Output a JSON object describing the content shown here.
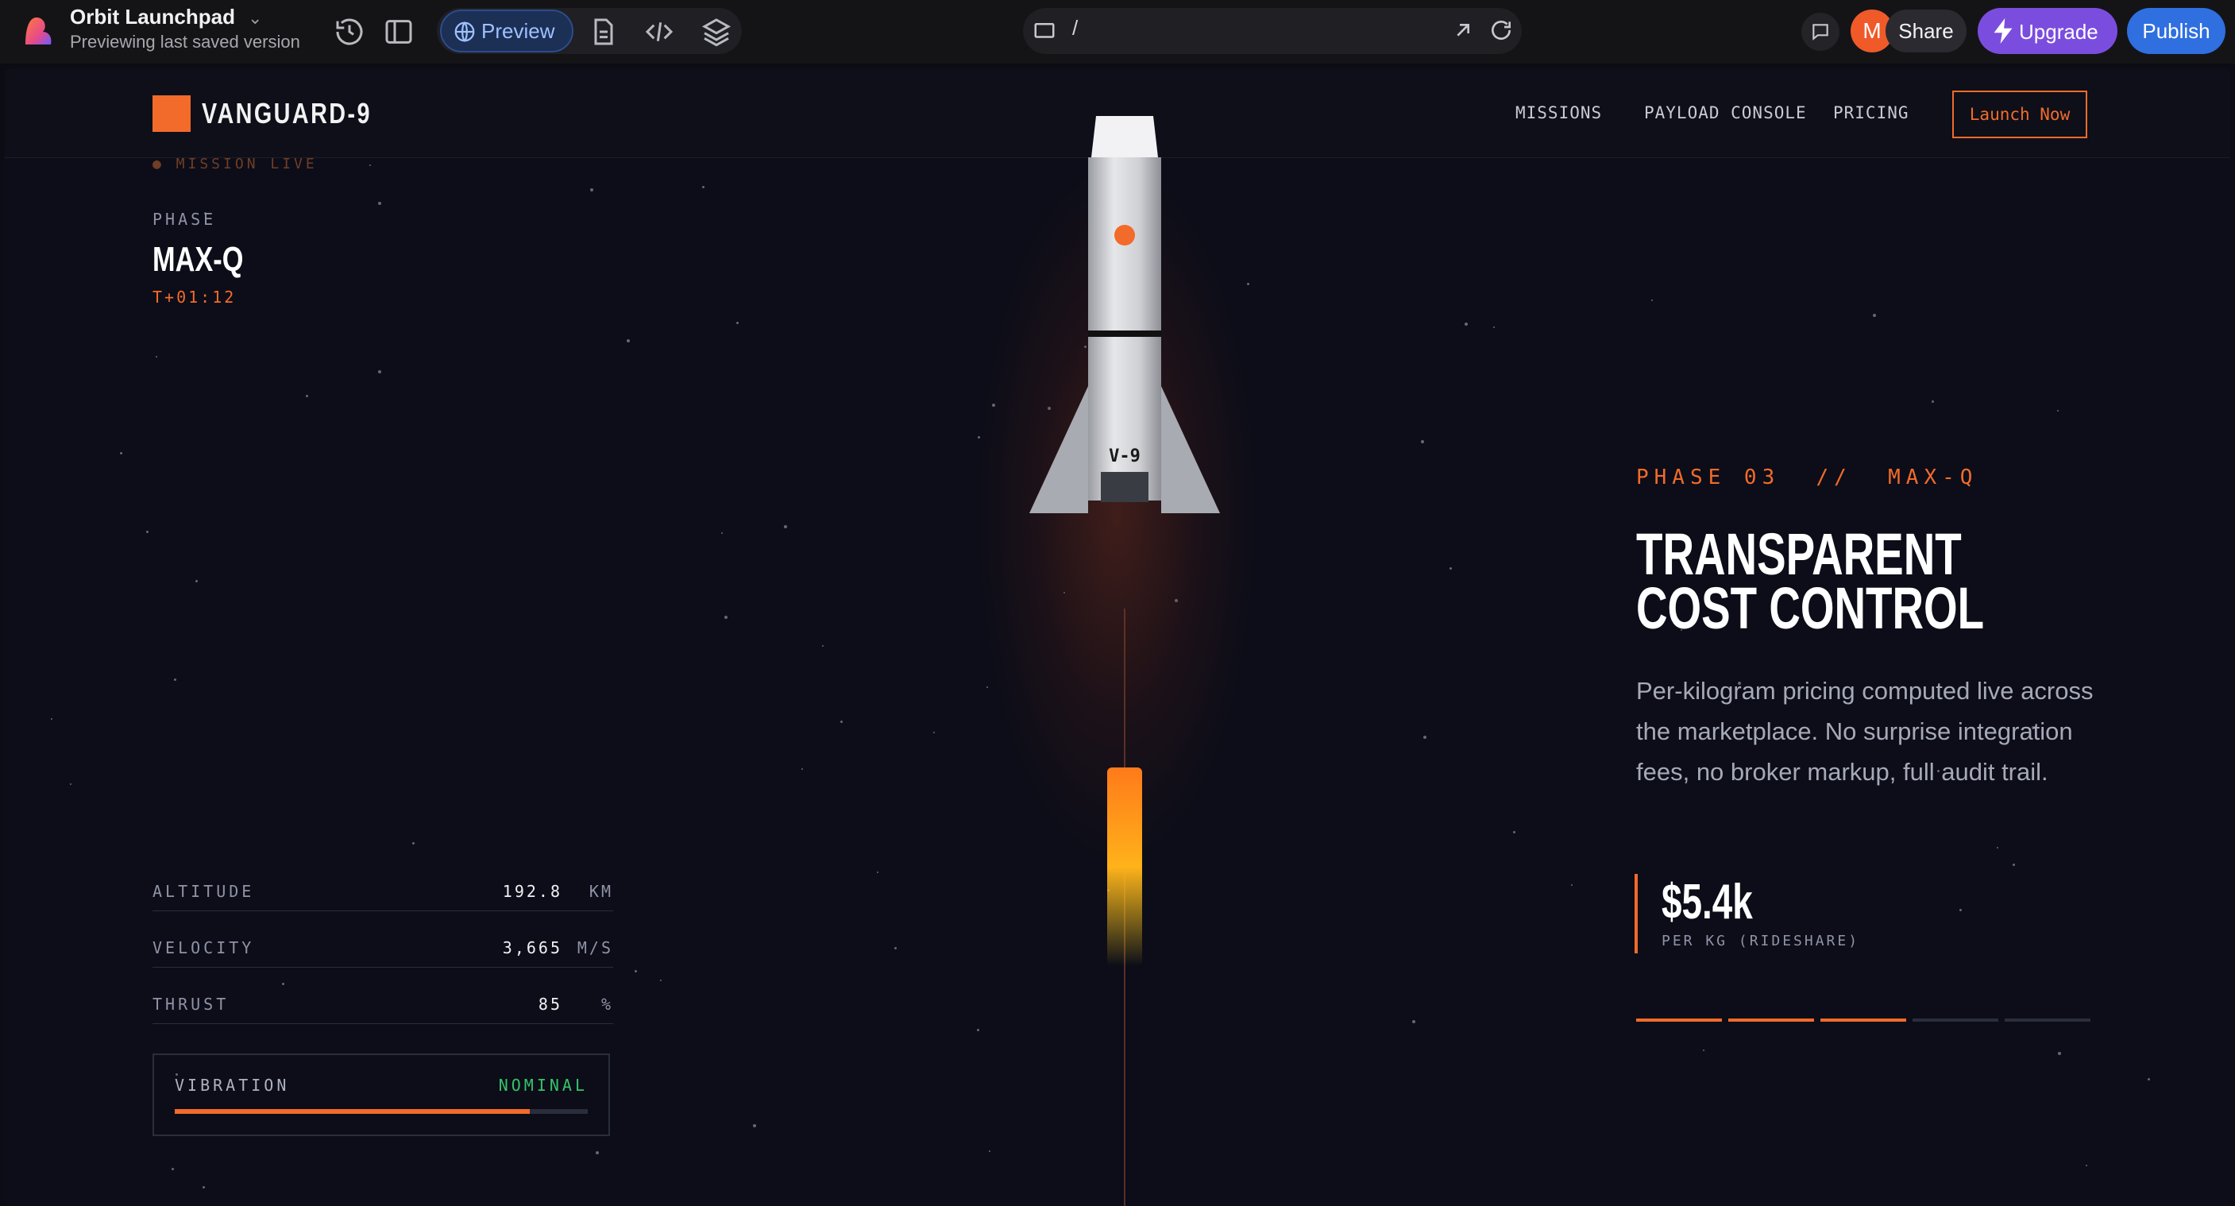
{
  "app": {
    "project_name": "Orbit Launchpad",
    "status": "Previewing last saved version",
    "preview_label": "Preview",
    "url_path": "/",
    "avatar_initial": "M",
    "share_label": "Share",
    "upgrade_label": "Upgrade",
    "publish_label": "Publish",
    "icons": [
      "history-icon",
      "sidebar-toggle-icon",
      "globe-icon",
      "file-icon",
      "code-icon",
      "layers-icon",
      "device-icon",
      "external-link-icon",
      "refresh-icon",
      "comment-icon",
      "bolt-icon"
    ],
    "colors": {
      "preview": "#1c2f55",
      "upgrade": "#7b4dde",
      "publish": "#2f6fe0"
    }
  },
  "site": {
    "brand": "VANGUARD-9",
    "nav": [
      "MISSIONS",
      "PAYLOAD CONSOLE",
      "PRICING"
    ],
    "cta": "Launch Now",
    "accent": "#f26b2a",
    "mission_tag": "● MISSION LIVE",
    "phase_label": "PHASE",
    "phase_value": "MAX-Q",
    "phase_time": "T+01:12",
    "telemetry": [
      {
        "label": "ALTITUDE",
        "value": "192.8",
        "unit": "KM"
      },
      {
        "label": "VELOCITY",
        "value": "3,665",
        "unit": "M/S"
      },
      {
        "label": "THRUST",
        "value": "85",
        "unit": "%"
      }
    ],
    "vibration": {
      "label": "VIBRATION",
      "status": "NOMINAL",
      "level_percent": 86,
      "status_color": "#35c46a"
    },
    "rocket_label": "V-9",
    "kicker": "PHASE 03  //  MAX-Q",
    "headline": "TRANSPARENT COST CONTROL",
    "body": "Per-kilogram pricing computed live across the marketplace. No surprise integration fees, no broker markup, full audit trail.",
    "price": "$5.4k",
    "price_sub": "PER KG (RIDESHARE)",
    "progress": {
      "active_phases": 3,
      "total_phases": 5
    }
  }
}
